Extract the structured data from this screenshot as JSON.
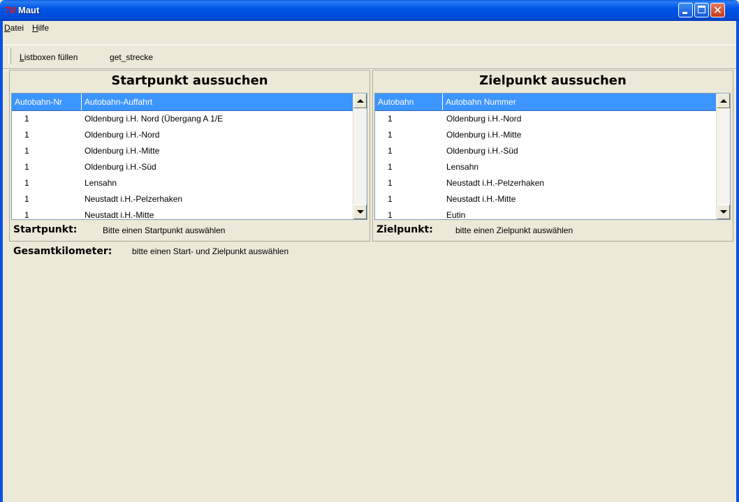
{
  "window": {
    "icon_text": "78",
    "title": "Maut"
  },
  "menu": [
    {
      "label_ul": "D",
      "label_rest": "atei"
    },
    {
      "label_ul": "H",
      "label_rest": "ilfe"
    }
  ],
  "toolbar": {
    "fill_ul": "L",
    "fill_rest": "istboxen füllen",
    "strecke_ul": "g",
    "strecke_rest": "et_strecke"
  },
  "start_panel": {
    "title": "Startpunkt aussuchen",
    "columns": [
      "Autobahn-Nr",
      "Autobahn-Auffahrt"
    ],
    "rows": [
      [
        "1",
        "Oldenburg i.H. Nord (Übergang A 1/E"
      ],
      [
        "1",
        "Oldenburg i.H.-Nord"
      ],
      [
        "1",
        "Oldenburg i.H.-Mitte"
      ],
      [
        "1",
        "Oldenburg i.H.-Süd"
      ],
      [
        "1",
        "Lensahn"
      ],
      [
        "1",
        "Neustadt i.H.-Pelzerhaken"
      ],
      [
        "1",
        "Neustadt i.H.-Mitte"
      ]
    ],
    "status_label": "Startpunkt:",
    "status_value": "Bitte einen Startpunkt auswählen"
  },
  "end_panel": {
    "title": "Zielpunkt aussuchen",
    "columns": [
      "Autobahn",
      "Autobahn Nummer"
    ],
    "rows": [
      [
        "1",
        "Oldenburg i.H.-Nord"
      ],
      [
        "1",
        "Oldenburg i.H.-Mitte"
      ],
      [
        "1",
        "Oldenburg i.H.-Süd"
      ],
      [
        "1",
        "Lensahn"
      ],
      [
        "1",
        "Neustadt i.H.-Pelzerhaken"
      ],
      [
        "1",
        "Neustadt i.H.-Mitte"
      ],
      [
        "1",
        "Eutin"
      ]
    ],
    "status_label": "Zielpunkt:",
    "status_value": "bitte einen Zielpunkt auswählen"
  },
  "total": {
    "label": "Gesamtkilometer:",
    "value": "bitte einen Start- und Zielpunkt auswählen"
  },
  "colors": {
    "titlebar": "#0055e5",
    "list_header": "#3d95ff",
    "window_bg": "#ece9d8"
  }
}
